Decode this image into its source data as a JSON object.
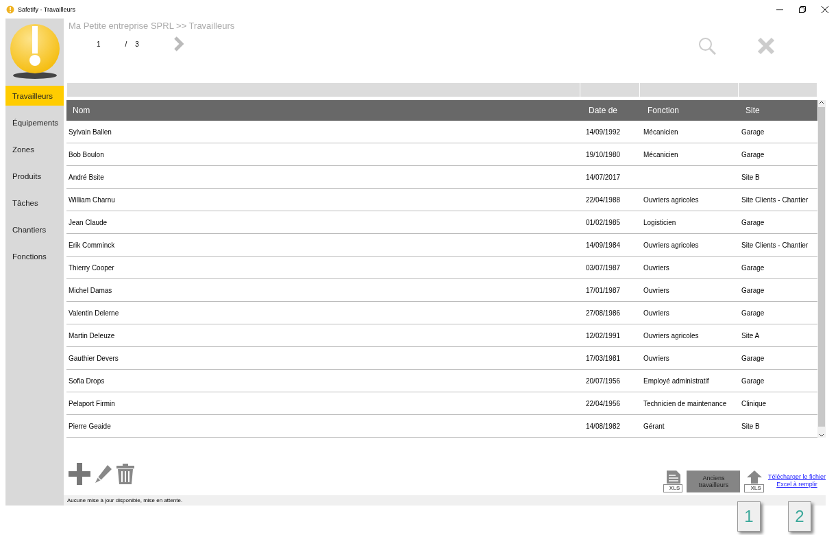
{
  "window": {
    "title": "Safetify - Travailleurs"
  },
  "sidebar": {
    "items": [
      {
        "label": "Travailleurs",
        "selected": true
      },
      {
        "label": "Équipements",
        "selected": false
      },
      {
        "label": "Zones",
        "selected": false
      },
      {
        "label": "Produits",
        "selected": false
      },
      {
        "label": "Tâches",
        "selected": false
      },
      {
        "label": "Chantiers",
        "selected": false
      },
      {
        "label": "Fonctions",
        "selected": false
      }
    ]
  },
  "breadcrumb": "Ma Petite entreprise SPRL >> Travailleurs",
  "pager": {
    "current": "1",
    "separator": "/",
    "total": "3"
  },
  "table": {
    "columns": [
      "Nom",
      "Date de",
      "Fonction",
      "Site"
    ],
    "rows": [
      [
        "Sylvain Ballen",
        "14/09/1992",
        "Mécanicien",
        "Garage"
      ],
      [
        "Bob Boulon",
        "19/10/1980",
        "Mécanicien",
        "Garage"
      ],
      [
        "André Bsite",
        "14/07/2017",
        "",
        "Site B"
      ],
      [
        "William Charnu",
        "22/04/1988",
        "Ouvriers agricoles",
        "Site Clients - Chantier"
      ],
      [
        "Jean Claude",
        "01/02/1985",
        "Logisticien",
        "Garage"
      ],
      [
        "Erik Comminck",
        "14/09/1984",
        "Ouvriers agricoles",
        "Site Clients - Chantier"
      ],
      [
        "Thierry Cooper",
        "03/07/1987",
        "Ouvriers",
        "Garage"
      ],
      [
        "Michel Damas",
        "17/01/1987",
        "Ouvriers",
        "Garage"
      ],
      [
        "Valentin Delerne",
        "27/08/1986",
        "Ouvriers",
        "Garage"
      ],
      [
        "Martin Deleuze",
        "12/02/1991",
        "Ouvriers agricoles",
        "Site A"
      ],
      [
        "Gauthier Devers",
        "17/03/1981",
        "Ouvriers",
        "Garage"
      ],
      [
        "Sofia Drops",
        "20/07/1956",
        "Employé administratif",
        "Garage"
      ],
      [
        "Pelaport Firmin",
        "22/04/1956",
        "Technicien de maintenance",
        "Clinique"
      ],
      [
        "Pierre Geaide",
        "14/08/1982",
        "Gérant",
        "Site B"
      ]
    ]
  },
  "toolbar": {
    "old_workers_button": "Anciens travailleurs",
    "download_link": [
      "Télécharger le fichier",
      "Excel à remplir"
    ],
    "xls_labels": [
      "XLS",
      "XLS"
    ]
  },
  "status_bar": "Aucune mise à jour disponible, mise en attente.",
  "callouts": [
    "1",
    "2"
  ]
}
